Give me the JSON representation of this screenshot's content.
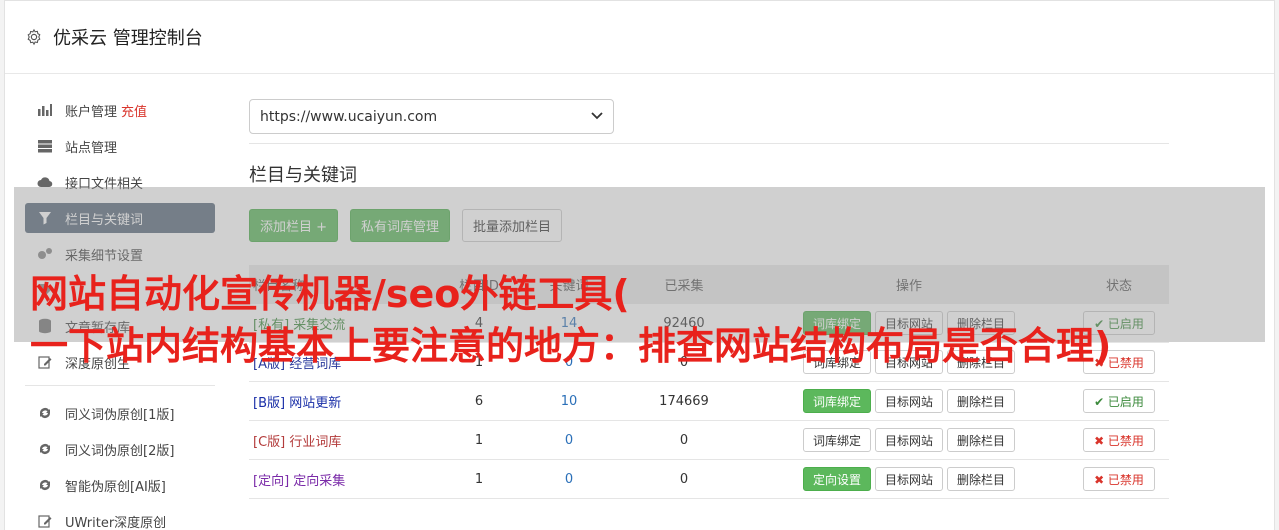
{
  "header": {
    "title": "优采云 管理控制台"
  },
  "sidebar": {
    "items": [
      {
        "label": "账户管理",
        "extra": "充值",
        "icon": "bar-chart-icon"
      },
      {
        "label": "站点管理",
        "icon": "server-icon"
      },
      {
        "label": "接口文件相关",
        "icon": "cloud-upload-icon"
      },
      {
        "label": "栏目与关键词",
        "icon": "filter-icon",
        "active": true
      },
      {
        "label": "采集细节设置",
        "icon": "gears-icon"
      },
      {
        "label": "",
        "icon": "tag-icon"
      },
      {
        "label": "文章暂存库",
        "icon": "database-icon"
      },
      {
        "label": "深度原创生",
        "icon": "edit-icon"
      }
    ],
    "items2": [
      {
        "label": "同义词伪原创[1版]",
        "icon": "refresh-icon"
      },
      {
        "label": "同义词伪原创[2版]",
        "icon": "refresh-icon"
      },
      {
        "label": "智能伪原创[AI版]",
        "icon": "refresh-icon"
      },
      {
        "label": "UWriter深度原创",
        "icon": "edit-icon"
      }
    ]
  },
  "main": {
    "site_select": "https://www.ucaiyun.com",
    "section_title": "栏目与关键词",
    "buttons": {
      "add": "添加栏目 +",
      "private": "私有词库管理",
      "batch": "批量添加栏目"
    },
    "table": {
      "headers": {
        "name": "栏目名称",
        "id": "栏目ID",
        "kw": "关键词",
        "cnt": "已采集",
        "ops": "操作",
        "status": "状态"
      },
      "rows": [
        {
          "tag": "[私有]",
          "name": "采集交流",
          "id": "4",
          "kw": "14",
          "cnt": "92460",
          "op1": "词库绑定",
          "op1_green": true,
          "op2": "目标网站",
          "op3": "删除栏目",
          "status": "✔ 已启用",
          "on": true,
          "color": "#3c8a3c"
        },
        {
          "tag": "[A版]",
          "name": "经营词库",
          "id": "1",
          "kw": "0",
          "cnt": "0",
          "op1": "词库绑定",
          "op1_green": false,
          "op2": "目标网站",
          "op3": "删除栏目",
          "status": "✖ 已禁用",
          "on": false,
          "color": "#2a3a9c"
        },
        {
          "tag": "[B版]",
          "name": "网站更新",
          "id": "6",
          "kw": "10",
          "cnt": "174669",
          "op1": "词库绑定",
          "op1_green": true,
          "op2": "目标网站",
          "op3": "删除栏目",
          "status": "✔ 已启用",
          "on": true,
          "color": "#1a2fa8"
        },
        {
          "tag": "[C版]",
          "name": "行业词库",
          "id": "1",
          "kw": "0",
          "cnt": "0",
          "op1": "词库绑定",
          "op1_green": false,
          "op2": "目标网站",
          "op3": "删除栏目",
          "status": "✖ 已禁用",
          "on": false,
          "color": "#b33b3b"
        },
        {
          "tag": "[定向]",
          "name": "定向采集",
          "id": "1",
          "kw": "0",
          "cnt": "0",
          "op1": "定向设置",
          "op1_green": true,
          "op2": "目标网站",
          "op3": "删除栏目",
          "status": "✖ 已禁用",
          "on": false,
          "color": "#7a2aa8"
        }
      ]
    }
  },
  "overlay": {
    "line1": "网站自动化宣传机器/seo外链工具(",
    "line2": "一下站内结构基本上要注意的地方：排查网站结构布局是否合理)"
  },
  "colors": {
    "accent_green": "#5cb85c",
    "active_nav": "#5a6a7d",
    "overlay_text": "#e8221c"
  }
}
